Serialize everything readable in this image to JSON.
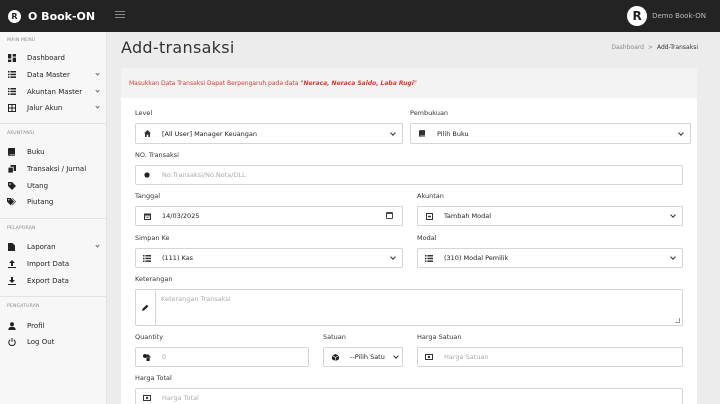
{
  "app": {
    "brand": "O Book-ON",
    "logo_letter": "R",
    "user_name": "Demo Book-ON"
  },
  "sidebar": {
    "sections": [
      {
        "title": "MAIN MENU"
      },
      {
        "title": "AKUNTANSI"
      },
      {
        "title": "PELAPORAN"
      },
      {
        "title": "PENGATURAN"
      }
    ],
    "items": [
      {
        "label": "Dashboard",
        "icon": "dashboard-icon"
      },
      {
        "label": "Data Master",
        "icon": "list-icon",
        "has_submenu": true
      },
      {
        "label": "Akuntan Master",
        "icon": "list-icon",
        "has_submenu": true
      },
      {
        "label": "Jalur Akun",
        "icon": "table-icon",
        "has_submenu": true
      },
      {
        "label": "Buku",
        "icon": "book-icon"
      },
      {
        "label": "Transaksi / Jurnal",
        "icon": "copy-icon"
      },
      {
        "label": "Utang",
        "icon": "tag-icon"
      },
      {
        "label": "Piutang",
        "icon": "tags-icon"
      },
      {
        "label": "Laporan",
        "icon": "file-icon",
        "has_submenu": true
      },
      {
        "label": "Import Data",
        "icon": "upload-icon"
      },
      {
        "label": "Export Data",
        "icon": "download-icon"
      },
      {
        "label": "Profil",
        "icon": "user-icon"
      },
      {
        "label": "Log Out",
        "icon": "power-icon"
      }
    ]
  },
  "page": {
    "title": "Add-transaksi",
    "breadcrumb": [
      "Dashboard",
      "Add-Transaksi"
    ],
    "breadcrumb_sep": ">"
  },
  "notice": {
    "text": "Masukkan Data Transaksi Dapat Berpengaruh pada data ",
    "emphasis": "\"Neraca, Neraca Saldo, Laba Rugi\"",
    "color": "#d43a34"
  },
  "form": {
    "level": {
      "label": "Level",
      "value": "[All User] Manager Keuangan",
      "icon": "home-icon"
    },
    "pembukuan": {
      "label": "Pembukuan",
      "value": "Pilih Buku",
      "icon": "book-icon"
    },
    "no_transaksi": {
      "label": "NO. Transaksi",
      "placeholder": "No.Transaksi/No.Nota/DLL",
      "icon": "circle-icon"
    },
    "tanggal": {
      "label": "Tanggal",
      "value": "14/03/2025",
      "icon": "calendar-icon"
    },
    "akuntan": {
      "label": "Akuntan",
      "value": "Tambah Modal",
      "icon": "square-icon"
    },
    "simpan_ke": {
      "label": "Simpan Ke",
      "value": "(111) Kas",
      "icon": "list-icon"
    },
    "modal": {
      "label": "Modal",
      "value": "(310) Modal Pemilik",
      "icon": "list-icon"
    },
    "keterangan": {
      "label": "Keterangan",
      "placeholder": "Keterangan Transaksi",
      "icon": "pencil-icon"
    },
    "quantity": {
      "label": "Quantity",
      "placeholder": "0",
      "icon": "shapes-icon"
    },
    "satuan": {
      "label": "Satuan",
      "value": "--Pilih Satu",
      "icon": "cube-icon"
    },
    "harga_satuan": {
      "label": "Harga Satuan",
      "placeholder": "Harga Satuan",
      "icon": "money-icon"
    },
    "harga_total": {
      "label": "Harga Total",
      "placeholder": "Harga Total",
      "icon": "money-icon"
    }
  }
}
